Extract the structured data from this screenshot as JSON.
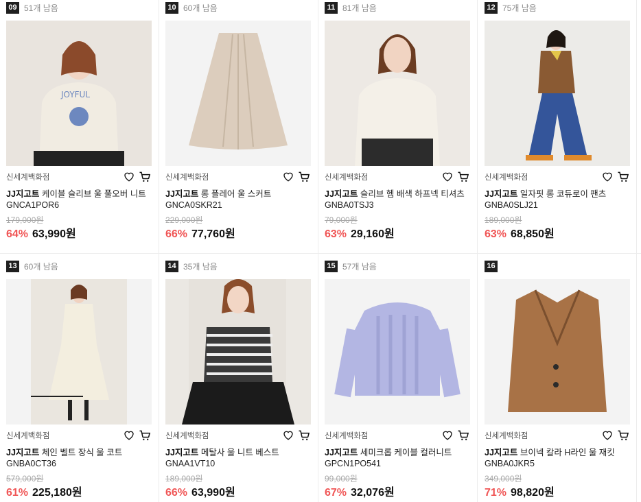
{
  "products": [
    {
      "rank": "09",
      "stock": "51개 남음",
      "store": "신세계백화점",
      "brand": "JJ지고트",
      "name": "케이블 슬리브 울 풀오버 니트 GNCA1POR6",
      "original": "179,000원",
      "discount": "64%",
      "price": "63,990원",
      "image": "cream-knit-sweater-with-flower-graphic"
    },
    {
      "rank": "10",
      "stock": "60개 남음",
      "store": "신세계백화점",
      "brand": "JJ지고트",
      "name": "롱 플레어 울 스커트 GNCA0SKR21",
      "original": "229,000원",
      "discount": "66%",
      "price": "77,760원",
      "image": "beige-pleated-long-skirt"
    },
    {
      "rank": "11",
      "stock": "81개 남음",
      "store": "신세계백화점",
      "brand": "JJ지고트",
      "name": "슬리브 헴 배색 하프넥 티셔츠 GNBA0TSJ3",
      "original": "79,000원",
      "discount": "63%",
      "price": "29,160원",
      "image": "ivory-turtleneck-top"
    },
    {
      "rank": "12",
      "stock": "75개 남음",
      "store": "신세계백화점",
      "brand": "JJ지고트",
      "name": "일자핏 롱 코듀로이 팬츠 GNBA0SLJ21",
      "original": "189,000원",
      "discount": "63%",
      "price": "68,850원",
      "image": "blue-wide-corduroy-pants"
    },
    {
      "rank": "13",
      "stock": "60개 남음",
      "store": "신세계백화점",
      "brand": "JJ지고트",
      "name": "체인 벨트 장식 울 코트 GNBA0CT36",
      "original": "579,000원",
      "discount": "61%",
      "price": "225,180원",
      "image": "ivory-long-belted-coat"
    },
    {
      "rank": "14",
      "stock": "35개 남음",
      "store": "신세계백화점",
      "brand": "JJ지고트",
      "name": "메탈사 울 니트 베스트 GNAA1VT10",
      "original": "189,000원",
      "discount": "66%",
      "price": "63,990원",
      "image": "striped-knit-vest"
    },
    {
      "rank": "15",
      "stock": "57개 남음",
      "store": "신세계백화점",
      "brand": "JJ지고트",
      "name": "세미크롭 케이블 컬러니트 GPCN1PO541",
      "original": "99,000원",
      "discount": "67%",
      "price": "32,076원",
      "image": "lavender-cable-knit"
    },
    {
      "rank": "16",
      "stock": "",
      "store": "신세계백화점",
      "brand": "JJ지고트",
      "name": "브이넥 칼라 H라인 울 재킷 GNBA0JKR5",
      "original": "349,000원",
      "discount": "71%",
      "price": "98,820원",
      "image": "camel-wool-jacket"
    }
  ],
  "colors": {
    "discount": "#f05656",
    "rank_bg": "#1f1f1f"
  }
}
